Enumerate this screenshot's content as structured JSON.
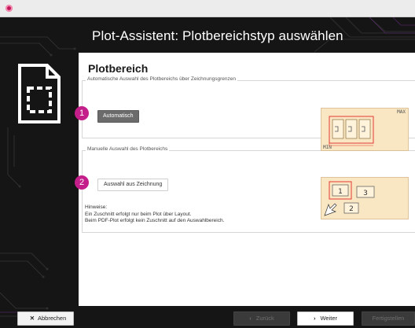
{
  "window": {
    "header_title": "Plot-Assistent: Plotbereichstyp auswählen",
    "accent_color": "#c41e8a"
  },
  "panel": {
    "title": "Plotbereich",
    "auto_group_label": "Automatische Auswahl des Plotbereichs über Zeichnungsgrenzen",
    "auto_step": "1",
    "auto_button": "Automatisch",
    "auto_diagram": {
      "max_label": "MAX",
      "min_label": "MIN"
    },
    "manual_group_label": "Manuelle Auswahl des Plotbereichs",
    "manual_step": "2",
    "manual_button": "Auswahl aus Zeichnung",
    "manual_diagram": {
      "sheet1": "1",
      "sheet2": "2",
      "sheet3": "3"
    },
    "hints": {
      "title": "Hinweise:",
      "line1": "Ein Zuschnitt erfolgt nur beim Plot über Layout.",
      "line2": "Beim PDF-Plot erfolgt kein Zuschnitt auf den Auswahlbereich."
    }
  },
  "footer": {
    "cancel": "Abbrechen",
    "back": "Zurück",
    "next": "Weiter",
    "finish": "Fertigstellen"
  },
  "icons": [
    "app-icon",
    "document-selection-icon",
    "close-icon",
    "chevron-left-icon",
    "chevron-right-icon",
    "cursor-arrow-icon"
  ]
}
